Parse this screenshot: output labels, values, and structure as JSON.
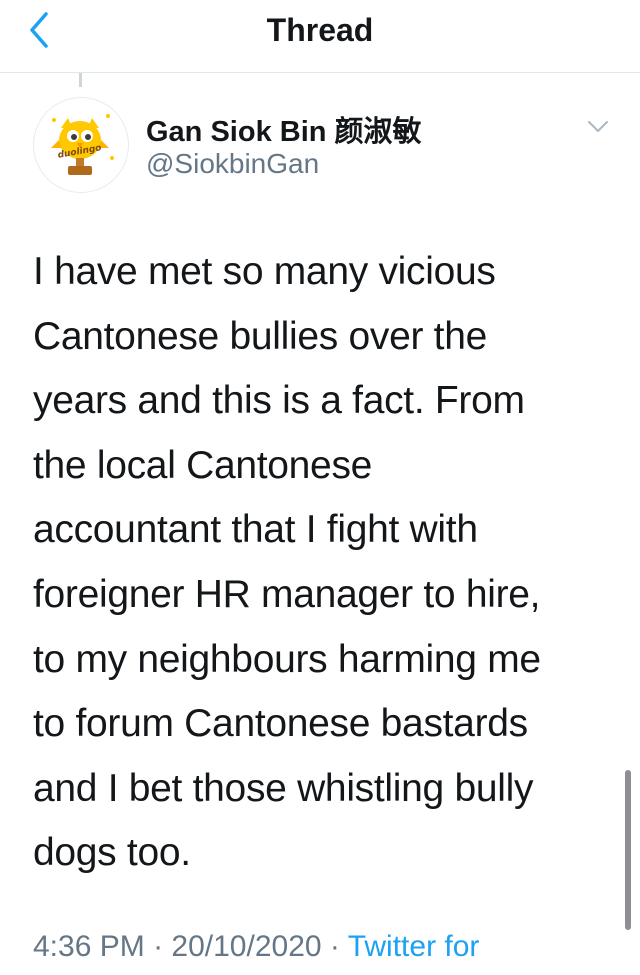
{
  "nav": {
    "title": "Thread",
    "back_icon": "chevron-left-icon",
    "accent_color": "#1da1f2"
  },
  "tweet": {
    "author_name": "Gan Siok Bin 颜淑敏",
    "author_handle": "@SiokbinGan",
    "avatar_icon": "duolingo-owl-avatar",
    "avatar_logo_text": "duolingo",
    "more_icon": "chevron-down-icon",
    "text_lines": [
      "I have met so many vicious",
      "Cantonese bullies over the",
      "years and this is a fact. From",
      "the local Cantonese",
      "accountant that I fight with",
      "foreigner HR manager to hire,",
      "to my neighbours harming me",
      "to forum Cantonese bastards",
      "and I bet those whistling bully",
      "dogs too."
    ],
    "time": "4:36 PM",
    "separator": "·",
    "date": "20/10/2020",
    "source": "Twitter for"
  }
}
